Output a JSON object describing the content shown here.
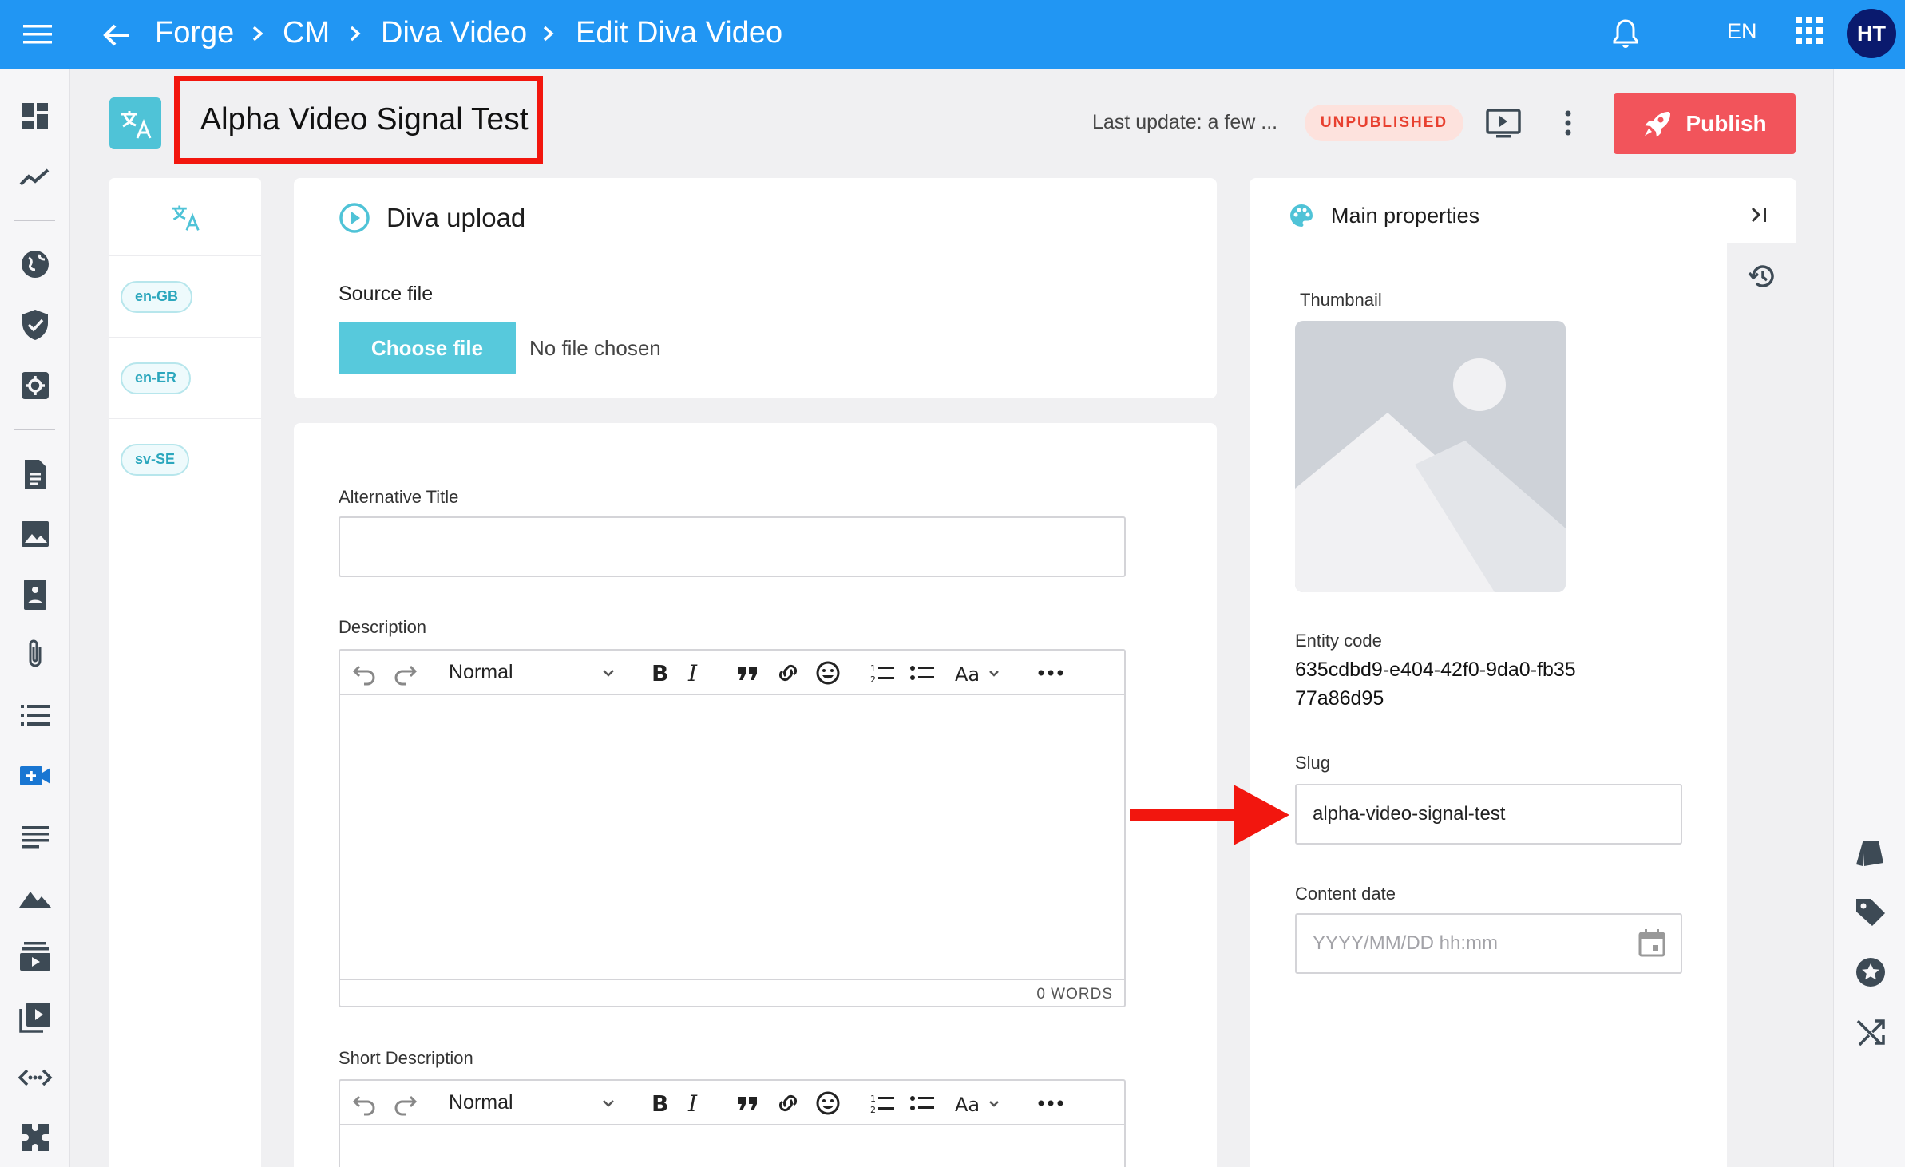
{
  "topbar": {
    "breadcrumb": [
      "Forge",
      "CM",
      "Diva Video",
      "Edit Diva Video"
    ],
    "language": "EN",
    "avatar_initials": "HT",
    "color": "#2196f3"
  },
  "leftnav": {
    "icons": [
      "dashboard-icon",
      "analytics-icon",
      "globe-icon",
      "shield-icon",
      "settings-icon",
      "document-icon",
      "image-icon",
      "photo-book-icon",
      "attachment-icon",
      "list-icon",
      "video-add-icon",
      "text-lines-icon",
      "landscape-icon",
      "playlist-icon",
      "video-library-icon",
      "code-icon",
      "extension-icon"
    ]
  },
  "header": {
    "title": "Alpha Video Signal Test",
    "last_update": "Last update: a few ...",
    "status": "UNPUBLISHED",
    "publish_label": "Publish"
  },
  "languages": [
    "en-GB",
    "en-ER",
    "sv-SE"
  ],
  "upload": {
    "title": "Diva upload",
    "source_file_label": "Source file",
    "choose_file": "Choose file",
    "no_file": "No file chosen"
  },
  "form": {
    "alt_title_label": "Alternative Title",
    "alt_title_value": "",
    "description_label": "Description",
    "short_description_label": "Short Description",
    "editor_style": "Normal",
    "word_count": "0 WORDS"
  },
  "properties": {
    "title": "Main properties",
    "thumbnail_label": "Thumbnail",
    "entity_code_label": "Entity code",
    "entity_code": "635cdbd9-e404-42f0-9da0-fb3577a86d95",
    "slug_label": "Slug",
    "slug_value": "alpha-video-signal-test",
    "content_date_label": "Content date",
    "content_date_placeholder": "YYYY/MM/DD hh:mm"
  },
  "colors": {
    "accent": "#57c9dc",
    "publish": "#f2545b",
    "highlight": "#f2160e"
  }
}
